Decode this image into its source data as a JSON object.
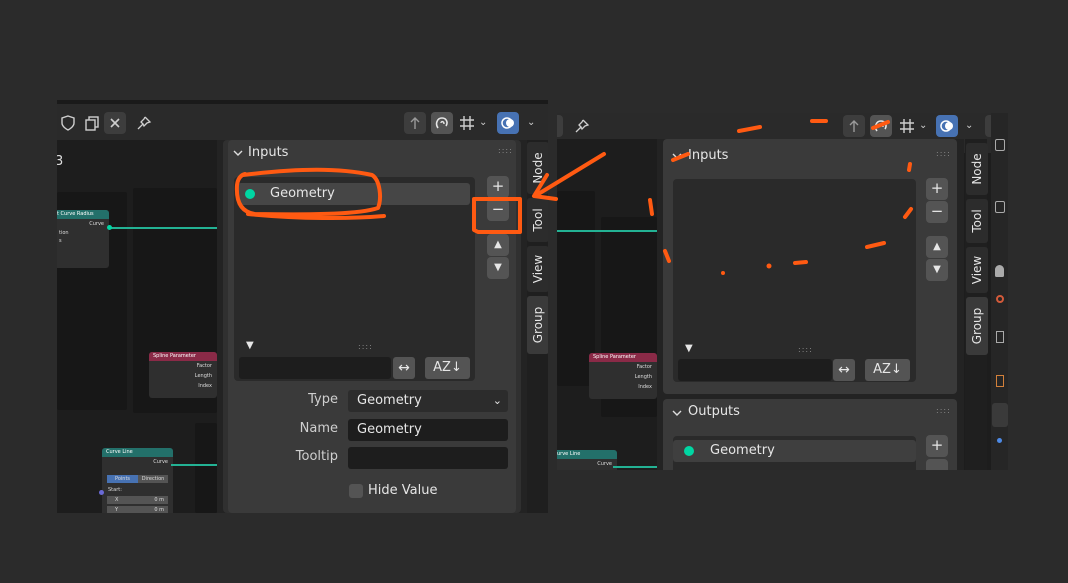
{
  "left": {
    "header": {
      "icons": [
        "shield-icon",
        "copy-icon",
        "close-icon",
        "pin-icon",
        "parent-arrow-icon",
        "snap-magnet-icon",
        "grid-snap-icon",
        "overlay-icon"
      ]
    },
    "nodes": {
      "curve_radius": {
        "title": "t Curve Radius",
        "socket": "Curve",
        "rows": [
          "",
          "",
          "tion",
          "s"
        ]
      },
      "spline_parameter": {
        "title": "Spline Parameter",
        "rows": [
          "Factor",
          "Length",
          "Index"
        ]
      },
      "curve_line": {
        "title": "Curve Line",
        "socket": "Curve",
        "mode_a": "Points",
        "mode_b": "Direction",
        "start": "Start:",
        "x_label": "X",
        "x_value": "0 m",
        "y_label": "Y",
        "y_value": "0 m"
      }
    },
    "tabs": [
      "Node",
      "Tool",
      "View",
      "Group"
    ],
    "inputs_panel": {
      "title": "Inputs",
      "items": [
        {
          "label": "Geometry"
        }
      ],
      "add": "+",
      "remove": "−",
      "up": "▲",
      "down": "▼",
      "filter_toggle": "▼",
      "filter_value": "",
      "invert_icon": "↔",
      "sort_icon": "AZ↓"
    },
    "properties": {
      "type_label": "Type",
      "type_value": "Geometry",
      "name_label": "Name",
      "name_value": "Geometry",
      "tooltip_label": "Tooltip",
      "tooltip_value": "",
      "hide_value_label": "Hide Value"
    },
    "left_edge_text": "3"
  },
  "right": {
    "nodes": {
      "spline_parameter": {
        "title": "Spline Parameter",
        "rows": [
          "Factor",
          "Length",
          "Index"
        ]
      },
      "curve_line": {
        "title": "urve Line",
        "socket": "Curve"
      }
    },
    "tabs": [
      "Node",
      "Tool",
      "View",
      "Group"
    ],
    "inputs_panel": {
      "title": "Inputs",
      "add": "+",
      "remove": "−",
      "up": "▲",
      "down": "▼",
      "filter_toggle": "▼",
      "filter_value": "",
      "invert_icon": "↔",
      "sort_icon": "AZ↓"
    },
    "outputs_panel": {
      "title": "Outputs",
      "items": [
        {
          "label": "Geometry"
        }
      ],
      "add": "+"
    }
  },
  "colors": {
    "background": "#2b2b2b",
    "panel": "#3a3a3a",
    "socket_geometry": "#00d6a3",
    "annotation": "#ff5a12",
    "accent_blue": "#4772b3"
  }
}
